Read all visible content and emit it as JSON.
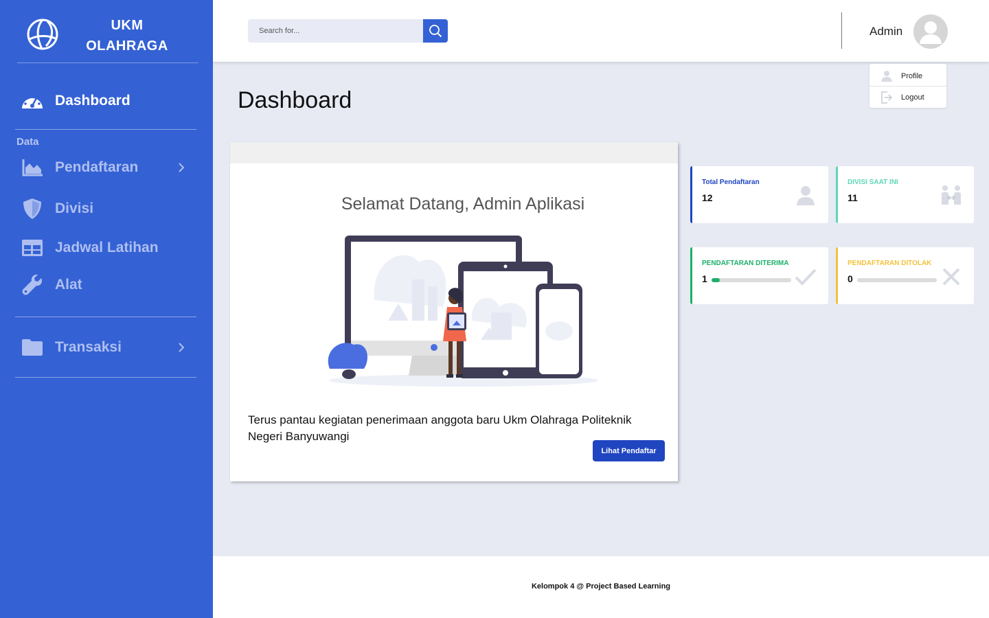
{
  "brand": {
    "line1": "UKM",
    "line2": "OLAHRAGA",
    "logo_icon": "volleyball-icon"
  },
  "sidebar": {
    "items_top": [
      {
        "label": "Dashboard",
        "icon": "dashboard-gauge-icon"
      }
    ],
    "section_label": "Data",
    "items": [
      {
        "label": "Pendaftaran",
        "icon": "area-chart-icon"
      },
      {
        "label": "Divisi",
        "icon": "shield-icon"
      },
      {
        "label": "Jadwal Latihan",
        "icon": "table-icon"
      },
      {
        "label": "Alat",
        "icon": "wrench-icon"
      }
    ],
    "items_bottom": [
      {
        "label": "Transaksi",
        "icon": "folder-icon"
      }
    ]
  },
  "topbar": {
    "search_placeholder": "Search for...",
    "admin_name": "Admin"
  },
  "dropdown": {
    "items": [
      {
        "label": "Profile"
      },
      {
        "label": "Logout"
      }
    ]
  },
  "page": {
    "title": "Dashboard"
  },
  "welcome": {
    "title": "Selamat Datang, Admin Aplikasi",
    "description": "Terus pantau kegiatan penerimaan anggota baru Ukm Olahraga Politeknik Negeri Banyuwangi",
    "button_label": "Lihat Pendaftar"
  },
  "stats": [
    {
      "label": "Total Pendaftaran",
      "value": "12",
      "color": "#1f45c0",
      "icon": "user-icon"
    },
    {
      "label": "DIVISI SAAT INI",
      "value": "11",
      "color": "#5fd6b6",
      "icon": "people-exchange-icon"
    },
    {
      "label": "PENDAFTARAN DITERIMA",
      "value": "1",
      "color": "#1cb06a",
      "icon": "check-icon",
      "progress": 0.1
    },
    {
      "label": "PENDAFTARAN DITOLAK",
      "value": "0",
      "color": "#f3c23c",
      "icon": "x-icon",
      "progress": 0
    }
  ],
  "footer": {
    "text": "Kelompok 4 @ Project Based Learning"
  },
  "colors": {
    "sidebar": "#3461d4",
    "primary_button": "#1f45c0",
    "background": "#e7eaf3"
  }
}
